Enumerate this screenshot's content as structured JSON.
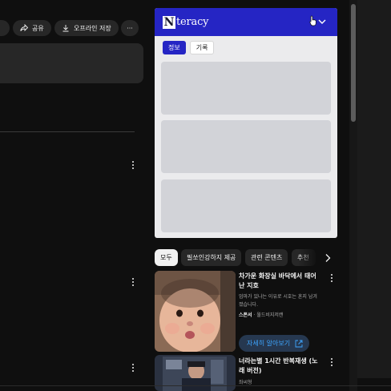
{
  "actions": {
    "share_label": "공유",
    "offline_label": "오프라인 저장",
    "more_label": "···"
  },
  "extension": {
    "logo_letter": "N",
    "logo_text": "teracy",
    "tabs": [
      {
        "label": "정보",
        "active": true
      },
      {
        "label": "기록",
        "active": false
      }
    ],
    "brand_color": "#2525c4"
  },
  "filters": [
    {
      "label": "모두",
      "selected": true
    },
    {
      "label": "필쏘인강하지 제공",
      "selected": false
    },
    {
      "label": "관련 콘텐츠",
      "selected": false
    },
    {
      "label": "추천",
      "selected": false
    }
  ],
  "recommendations": [
    {
      "title": "차가운 화장실 바닥에서 태어난 지호",
      "subtitle": "엄마가 있나는 이유로 시호는 혼지 남겨졌습니다.",
      "channel": "스폰서",
      "channel_extra": "· 월드비지저캔",
      "cta_label": "자세히 알아보기"
    },
    {
      "title": "너라는별 1시간 반복재생 (노래 버전)",
      "channel": "좌씨형"
    }
  ]
}
